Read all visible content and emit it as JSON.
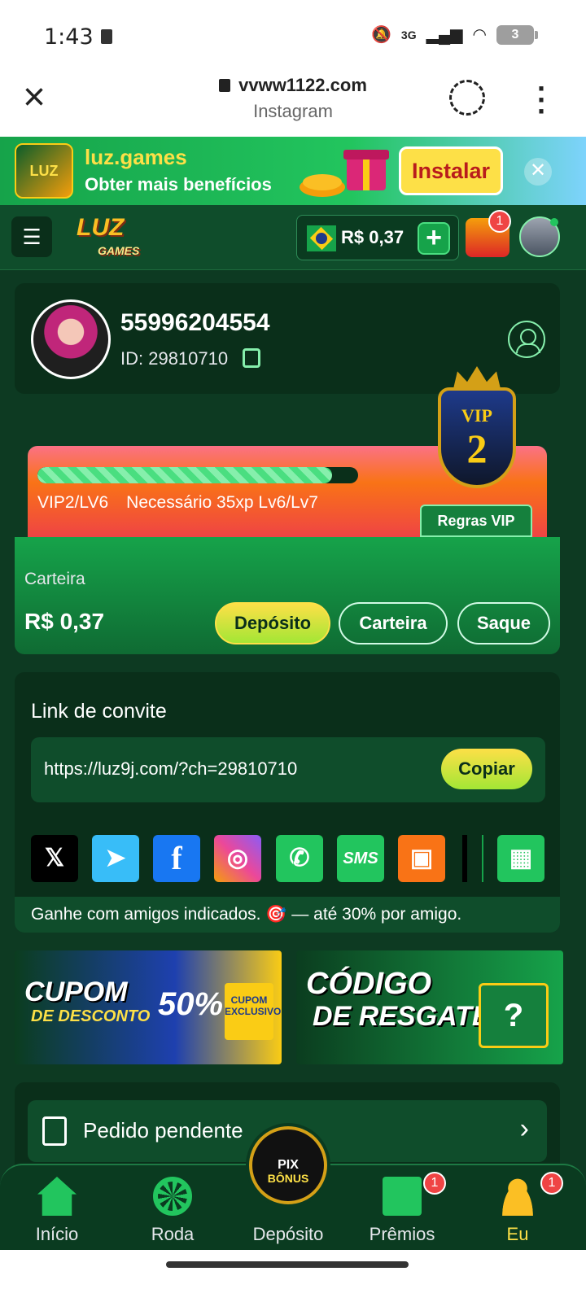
{
  "status_bar": {
    "time": "1:43",
    "network": "3G",
    "battery": "3"
  },
  "browser": {
    "url": "vvww1122.com",
    "source": "Instagram"
  },
  "install_banner": {
    "app_name": "luz.games",
    "tagline": "Obter mais benefícios",
    "install_label": "Instalar",
    "logo_text": "LUZ"
  },
  "header": {
    "logo_text": "LUZ",
    "logo_sub": "GAMES",
    "balance": "R$ 0,37",
    "notifications_count": "1",
    "add_label": "+"
  },
  "profile": {
    "username": "55996204554",
    "user_id": "ID: 29810710"
  },
  "vip": {
    "badge_label": "VIP",
    "badge_level": "2",
    "level_text": "VIP2/LV6",
    "requirement_text": "Necessário 35xp Lv6/Lv7",
    "progress": 0.92,
    "rules_label": "Regras VIP"
  },
  "wallet": {
    "label": "Carteira",
    "balance": "R$ 0,37",
    "deposit_label": "Depósito",
    "wallet_label": "Carteira",
    "withdraw_label": "Saque"
  },
  "invite": {
    "title": "Link de convite",
    "link": "https://luz9j.com/?ch=29810710",
    "copy_label": "Copiar",
    "socials": [
      "X",
      "Telegram",
      "Facebook",
      "Instagram",
      "WhatsApp",
      "SMS",
      "Kwai",
      "More"
    ],
    "sms_label": "SMS",
    "earn_text": "Ganhe com amigos indicados. 🎯 — até 30% por amigo."
  },
  "promos": {
    "coupon_title": "CUPOM",
    "coupon_sub": "DE DESCONTO",
    "coupon_pct": "50%",
    "coupon_ticket": "CUPOM EXCLUSIVO",
    "redeem_title": "CÓDIGO",
    "redeem_sub": "DE RESGATE",
    "redeem_box": "?"
  },
  "pending": {
    "label": "Pedido pendente"
  },
  "bottom_nav": {
    "items": [
      {
        "label": "Início"
      },
      {
        "label": "Roda"
      },
      {
        "label": "Depósito"
      },
      {
        "label": "Prêmios",
        "badge": "1"
      },
      {
        "label": "Eu",
        "badge": "1"
      }
    ],
    "pix_top": "PIX",
    "pix_bottom": "BÔNUS"
  },
  "colors": {
    "brand_green": "#0a2f1a",
    "accent_yellow": "#fde047",
    "vip_orange": "#f97316"
  }
}
